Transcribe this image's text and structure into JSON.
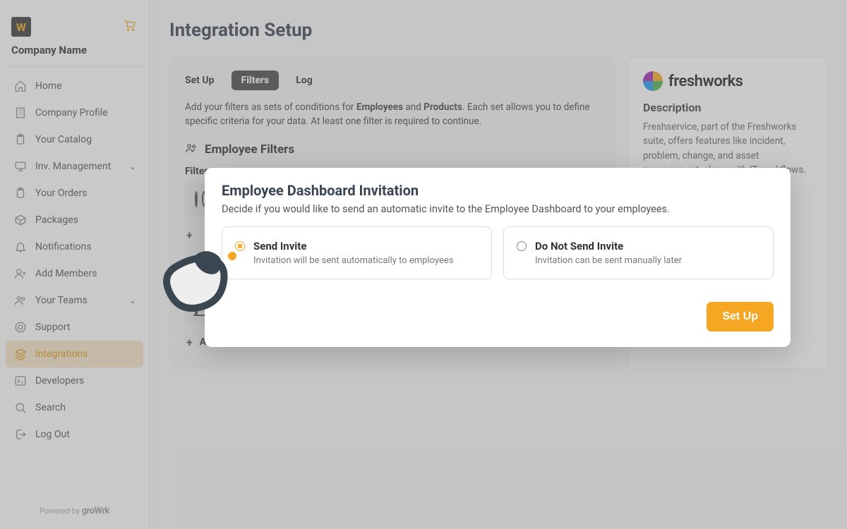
{
  "app": {
    "logo_letter": "W",
    "company_name": "Company Name",
    "powered_prefix": "Powered by",
    "powered_brand": "groWrk"
  },
  "sidebar": {
    "items": [
      {
        "label": "Home",
        "icon": "home-icon",
        "active": false
      },
      {
        "label": "Company Profile",
        "icon": "building-icon",
        "active": false
      },
      {
        "label": "Your Catalog",
        "icon": "clipboard-icon",
        "active": false
      },
      {
        "label": "Inv. Management",
        "icon": "monitor-icon",
        "active": false,
        "expandable": true
      },
      {
        "label": "Your Orders",
        "icon": "clipboard-icon",
        "active": false
      },
      {
        "label": "Packages",
        "icon": "package-icon",
        "active": false
      },
      {
        "label": "Notifications",
        "icon": "bell-icon",
        "active": false
      },
      {
        "label": "Add Members",
        "icon": "user-plus-icon",
        "active": false
      },
      {
        "label": "Your Teams",
        "icon": "users-icon",
        "active": false,
        "expandable": true
      },
      {
        "label": "Support",
        "icon": "support-icon",
        "active": false
      },
      {
        "label": "Integrations",
        "icon": "layers-icon",
        "active": true
      },
      {
        "label": "Developers",
        "icon": "terminal-icon",
        "active": false
      },
      {
        "label": "Search",
        "icon": "search-icon",
        "active": false
      },
      {
        "label": "Log Out",
        "icon": "logout-icon",
        "active": false
      }
    ]
  },
  "page": {
    "title": "Integration Setup",
    "tabs": [
      {
        "label": "Set Up",
        "active": false
      },
      {
        "label": "Filters",
        "active": true
      },
      {
        "label": "Log",
        "active": false
      }
    ],
    "intro_pre": "Add your filters as sets of conditions for ",
    "intro_b1": "Employees",
    "intro_mid": " and ",
    "intro_b2": "Products",
    "intro_post": ". Each set allows you to define specific criteria for your data. At least one filter is required to continue.",
    "employee_section": "Employee Filters",
    "filter_label": "Filter",
    "add_filter": "Add Filter"
  },
  "side_panel": {
    "brand": "freshworks",
    "desc_title": "Description",
    "desc_text": "Freshservice, part of the Freshworks suite, offers features like incident, problem, change, and asset management, along with IT workflows."
  },
  "modal": {
    "title": "Employee Dashboard Invitation",
    "subtitle": "Decide if you would like to send an automatic invite to the Employee Dashboard to your employees.",
    "options": [
      {
        "title": "Send Invite",
        "desc": "Invitation will be sent automatically to employees",
        "selected": true
      },
      {
        "title": "Do Not Send Invite",
        "desc": "Invitation can be sent manually later",
        "selected": false
      }
    ],
    "primary": "Set Up"
  }
}
